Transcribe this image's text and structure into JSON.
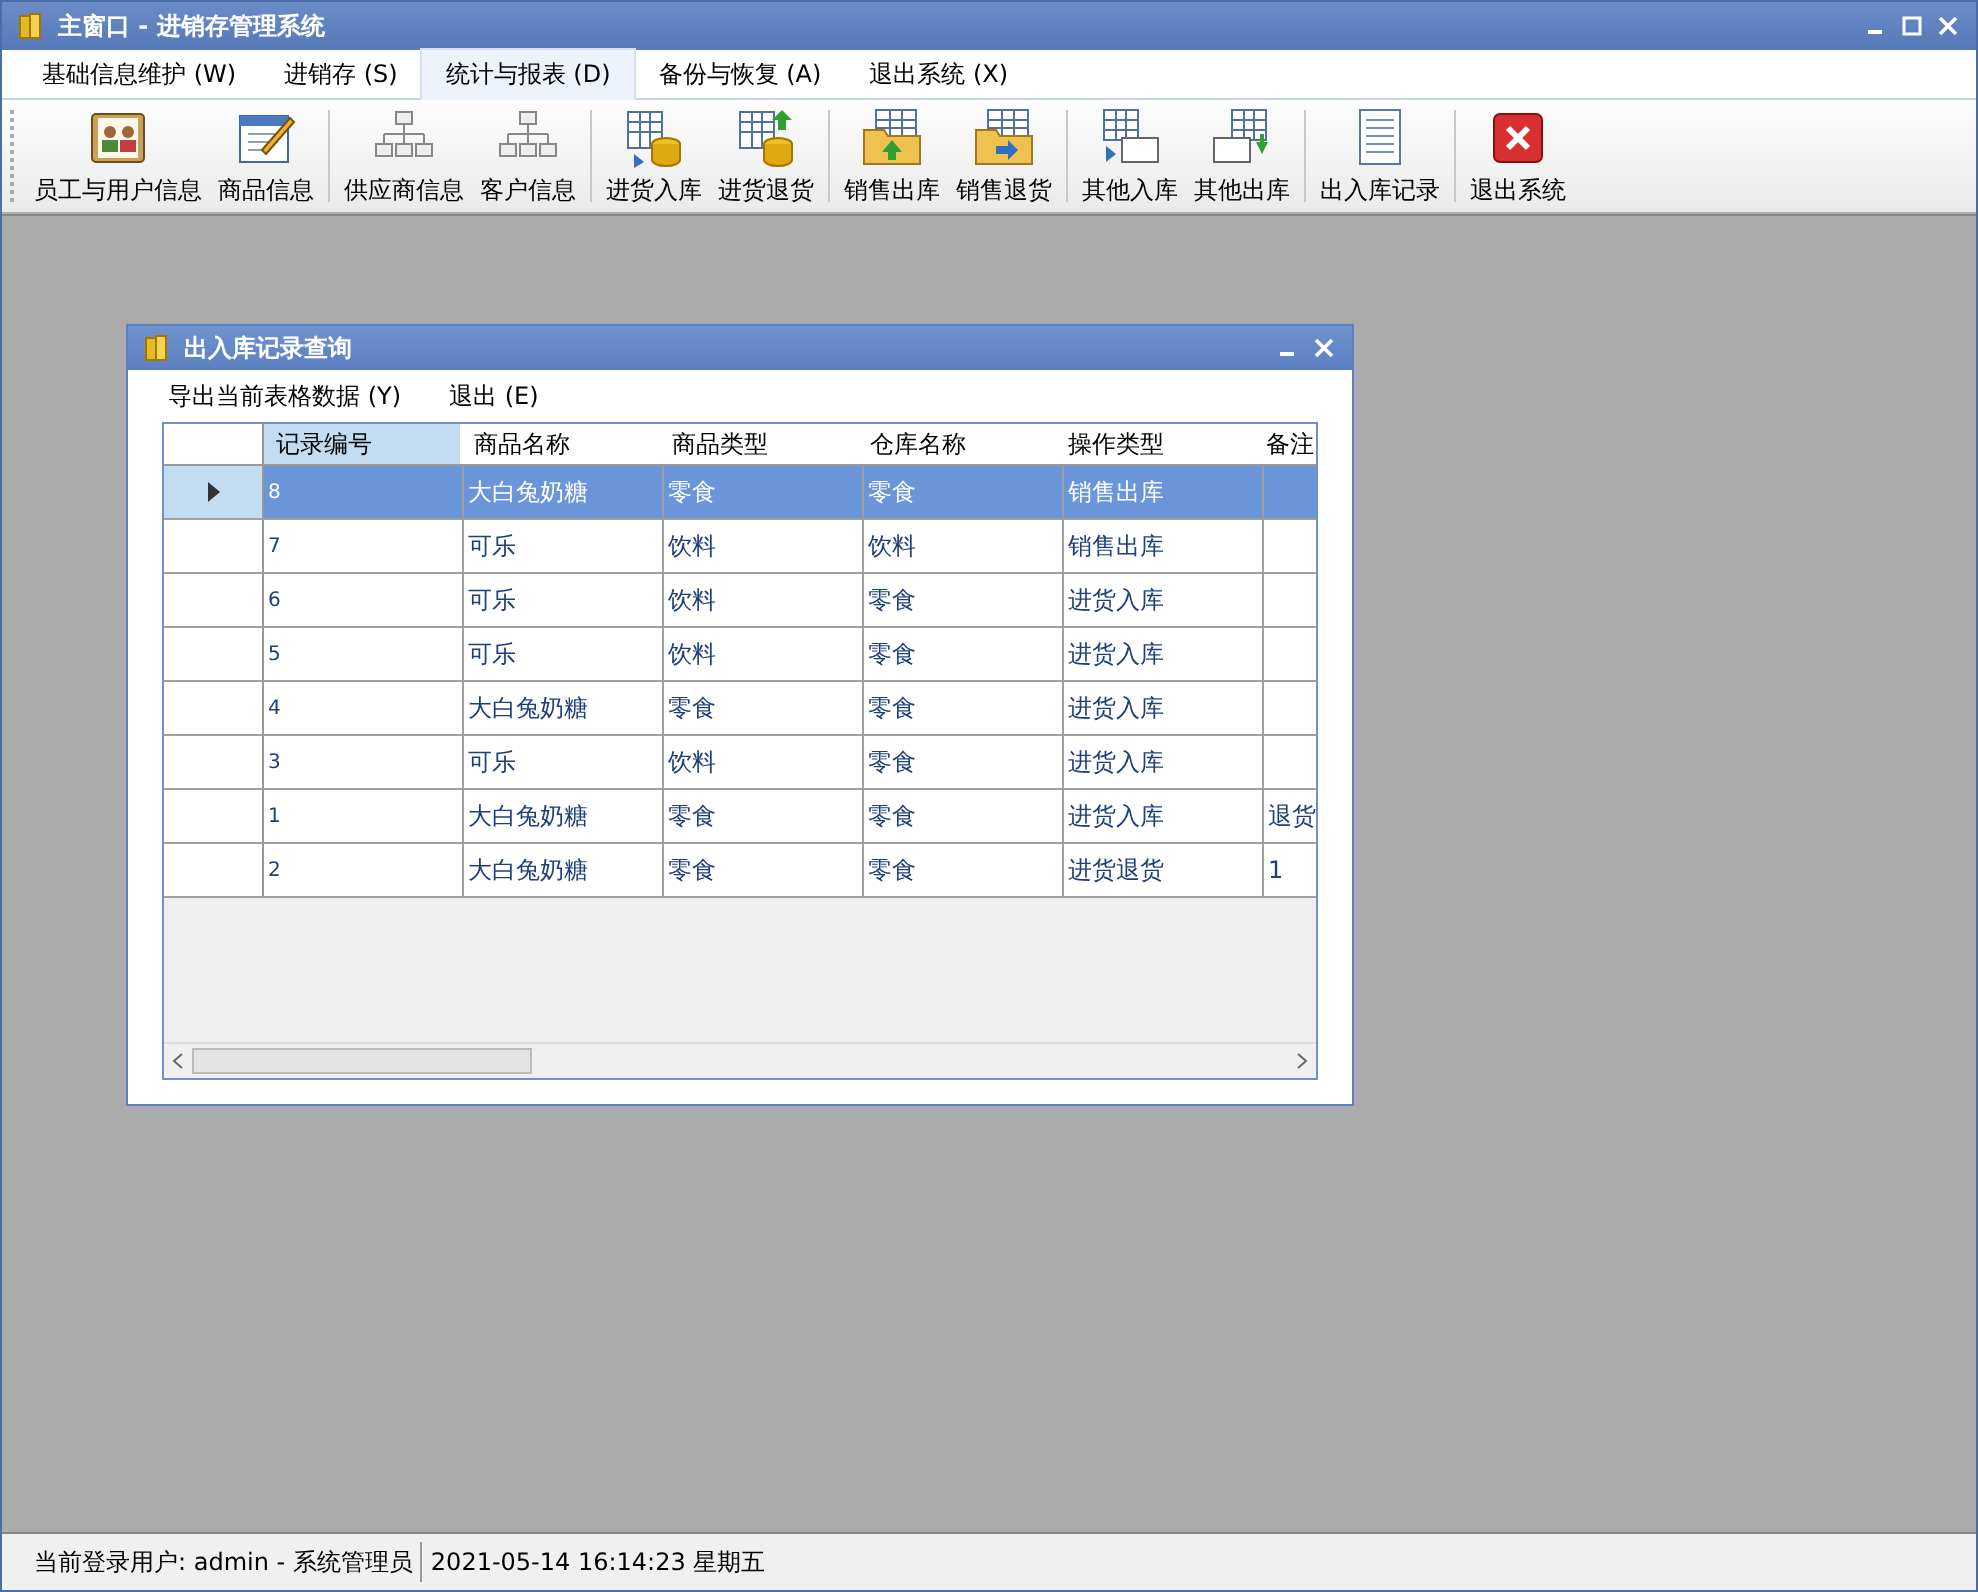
{
  "window": {
    "title": "主窗口 - 进销存管理系统"
  },
  "menu": [
    {
      "label": "基础信息维护 (W)",
      "selected": false
    },
    {
      "label": "进销存 (S)",
      "selected": false
    },
    {
      "label": "统计与报表 (D)",
      "selected": true
    },
    {
      "label": "备份与恢复 (A)",
      "selected": false
    },
    {
      "label": "退出系统 (X)",
      "selected": false
    }
  ],
  "toolbar": [
    [
      "员工与用户信息",
      "商品信息"
    ],
    [
      "供应商信息",
      "客户信息"
    ],
    [
      "进货入库",
      "进货退货"
    ],
    [
      "销售出库",
      "销售退货"
    ],
    [
      "其他入库",
      "其他出库"
    ],
    [
      "出入库记录"
    ],
    [
      "退出系统"
    ]
  ],
  "child_window": {
    "title": "出入库记录查询",
    "menu": [
      "导出当前表格数据 (Y)",
      "退出 (E)"
    ],
    "table": {
      "columns": [
        {
          "label": "记录编号",
          "selected": true
        },
        {
          "label": "商品名称",
          "selected": false
        },
        {
          "label": "商品类型",
          "selected": false
        },
        {
          "label": "仓库名称",
          "selected": false
        },
        {
          "label": "操作类型",
          "selected": false
        },
        {
          "label": "备注",
          "selected": false
        }
      ],
      "rows": [
        {
          "selected": true,
          "cells": [
            "8",
            "大白兔奶糖",
            "零食",
            "零食",
            "销售出库",
            null
          ]
        },
        {
          "selected": false,
          "cells": [
            "7",
            "可乐",
            "饮料",
            "饮料",
            "销售出库",
            null
          ]
        },
        {
          "selected": false,
          "cells": [
            "6",
            "可乐",
            "饮料",
            "零食",
            "进货入库",
            null
          ]
        },
        {
          "selected": false,
          "cells": [
            "5",
            "可乐",
            "饮料",
            "零食",
            "进货入库",
            null
          ]
        },
        {
          "selected": false,
          "cells": [
            "4",
            "大白兔奶糖",
            "零食",
            "零食",
            "进货入库",
            null
          ]
        },
        {
          "selected": false,
          "cells": [
            "3",
            "可乐",
            "饮料",
            "零食",
            "进货入库",
            null
          ]
        },
        {
          "selected": false,
          "cells": [
            "1",
            "大白兔奶糖",
            "零食",
            "零食",
            "进货入库",
            "退货"
          ]
        },
        {
          "selected": false,
          "cells": [
            "2",
            "大白兔奶糖",
            "零食",
            "零食",
            "进货退货",
            "1"
          ]
        }
      ]
    }
  },
  "status_bar": {
    "user": "当前登录用户: admin - 系统管理员",
    "datetime": "2021-05-14 16:14:23  星期五"
  }
}
